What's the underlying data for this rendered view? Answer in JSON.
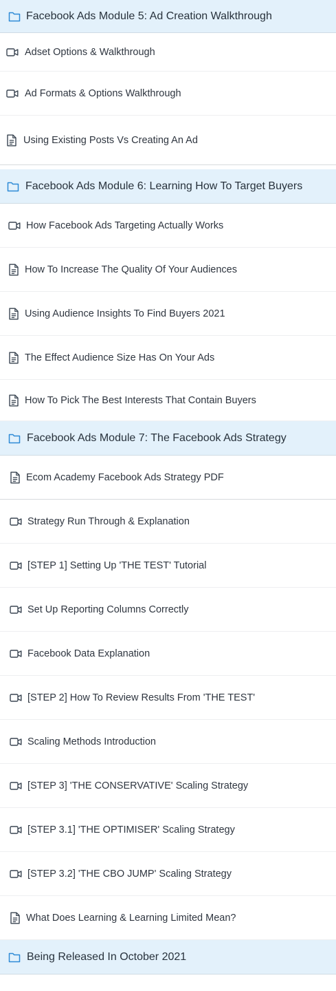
{
  "colors": {
    "module_bg": "#e3f1fb",
    "module_icon": "#2d8ad6",
    "lesson_icon": "#3a4552",
    "text": "#2f3640"
  },
  "rows": [
    {
      "type": "module",
      "icon": "folder-icon",
      "label": "Facebook Ads Module 5: Ad Creation Walkthrough"
    },
    {
      "type": "lesson",
      "icon": "video-icon",
      "label": "Adset Options & Walkthrough"
    },
    {
      "type": "lesson",
      "icon": "video-icon",
      "label": "Ad Formats & Options Walkthrough"
    },
    {
      "type": "lesson",
      "icon": "document-icon",
      "label": "Using Existing Posts Vs Creating An Ad"
    },
    {
      "type": "module",
      "icon": "folder-icon",
      "label": "Facebook Ads Module 6: Learning How To Target Buyers"
    },
    {
      "type": "lesson",
      "icon": "video-icon",
      "label": "How Facebook Ads Targeting Actually Works"
    },
    {
      "type": "lesson",
      "icon": "document-icon",
      "label": "How To Increase The Quality Of Your Audiences"
    },
    {
      "type": "lesson",
      "icon": "document-icon",
      "label": "Using Audience Insights To Find Buyers 2021"
    },
    {
      "type": "lesson",
      "icon": "document-icon",
      "label": "The Effect Audience Size Has On Your Ads"
    },
    {
      "type": "lesson",
      "icon": "document-icon",
      "label": "How To Pick The Best Interests That Contain Buyers"
    },
    {
      "type": "module",
      "icon": "folder-icon",
      "label": "Facebook Ads Module 7: The Facebook Ads Strategy"
    },
    {
      "type": "lesson",
      "icon": "document-icon",
      "label": "Ecom Academy Facebook Ads Strategy PDF"
    },
    {
      "type": "lesson",
      "icon": "video-icon",
      "label": "Strategy Run Through & Explanation"
    },
    {
      "type": "lesson",
      "icon": "video-icon",
      "label": "[STEP 1] Setting Up 'THE TEST' Tutorial"
    },
    {
      "type": "lesson",
      "icon": "video-icon",
      "label": "Set Up Reporting Columns Correctly"
    },
    {
      "type": "lesson",
      "icon": "video-icon",
      "label": "Facebook Data Explanation"
    },
    {
      "type": "lesson",
      "icon": "video-icon",
      "label": "[STEP 2] How To Review Results From 'THE TEST'"
    },
    {
      "type": "lesson",
      "icon": "video-icon",
      "label": "Scaling Methods Introduction"
    },
    {
      "type": "lesson",
      "icon": "video-icon",
      "label": "[STEP 3] 'THE CONSERVATIVE' Scaling Strategy"
    },
    {
      "type": "lesson",
      "icon": "video-icon",
      "label": "[STEP 3.1] 'THE OPTIMISER' Scaling Strategy"
    },
    {
      "type": "lesson",
      "icon": "video-icon",
      "label": "[STEP 3.2] 'THE CBO JUMP' Scaling Strategy"
    },
    {
      "type": "lesson",
      "icon": "document-icon",
      "label": "What Does Learning & Learning Limited Mean?"
    },
    {
      "type": "module",
      "icon": "folder-icon",
      "label": "Being Released In October 2021"
    }
  ]
}
